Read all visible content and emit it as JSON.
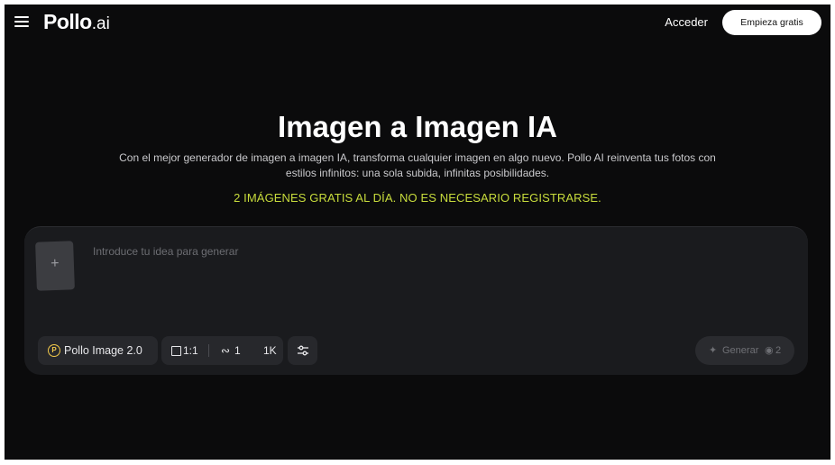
{
  "header": {
    "logo_text": "Pollo",
    "logo_suffix": ".ai",
    "login_label": "Acceder",
    "start_label": "Empieza gratis"
  },
  "hero": {
    "title": "Imagen a Imagen IA",
    "description": "Con el mejor generador de imagen a imagen IA, transforma cualquier imagen en algo nuevo. Pollo AI reinventa tus fotos con estilos infinitos: una sola subida, infinitas posibilidades.",
    "promo": "2 IMÁGENES GRATIS AL DÍA. NO ES NECESARIO REGISTRARSE."
  },
  "prompt_card": {
    "upload_symbol": "+",
    "placeholder": "Introduce tu idea para generar",
    "model_label": "Pollo Image 2.0",
    "aspect_ratio": "1:1",
    "image_count": "1",
    "resolution": "1K",
    "generate_label": "Generar",
    "generate_credits": "2"
  },
  "colors": {
    "background": "#0b0b0c",
    "card": "#1a1b1e",
    "promo": "#c8dc3c",
    "chip": "#27282c"
  },
  "icons": [
    "menu-icon",
    "image-upload-icon",
    "model-icon",
    "aspect-ratio-icon",
    "image-count-icon",
    "adjust-settings-icon",
    "sparkle-icon",
    "credit-icon"
  ]
}
